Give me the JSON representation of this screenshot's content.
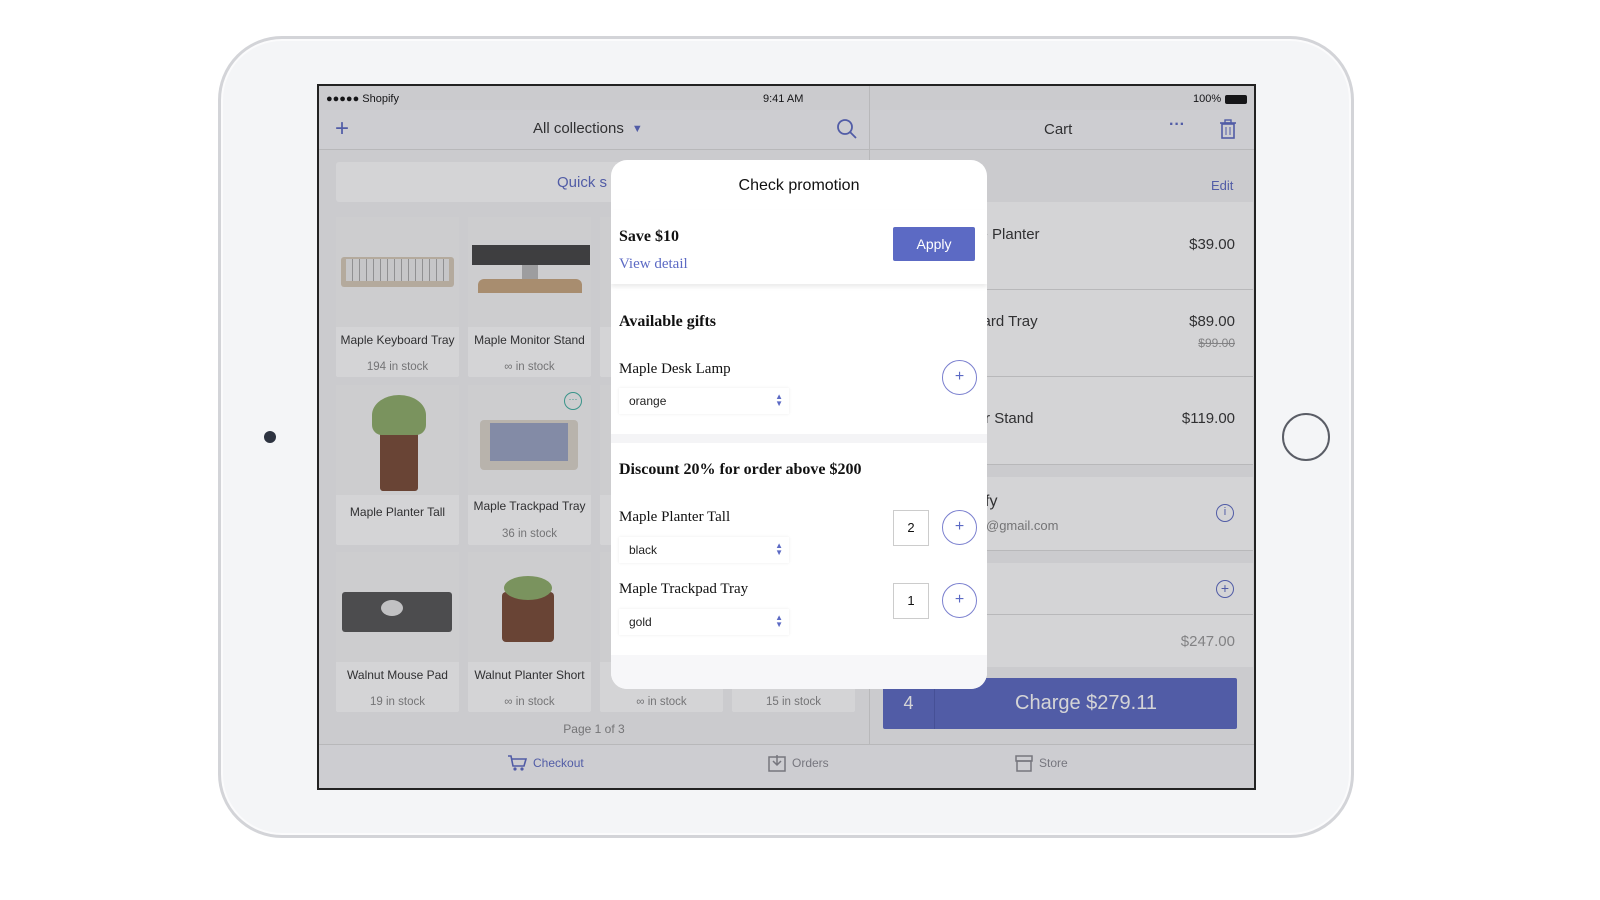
{
  "status_bar": {
    "carrier": "●●●●● Shopify",
    "time": "9:41 AM",
    "battery": "100%"
  },
  "products_header": {
    "add_icon": "plus-icon",
    "collection": "All collections",
    "search_icon": "search-icon"
  },
  "quick_sale": "Quick s",
  "products": [
    {
      "name": "Maple Keyboard Tray",
      "stock": "194 in stock"
    },
    {
      "name": "Maple Monitor Stand",
      "stock": "∞ in stock"
    },
    {
      "name": "Maple Planter Tall",
      "stock": ""
    },
    {
      "name": "Maple Trackpad Tray",
      "stock": "36 in stock"
    },
    {
      "name": "Walnut Mouse Pad",
      "stock": "19 in stock"
    },
    {
      "name": "Walnut Planter Short",
      "stock": "∞ in stock"
    },
    {
      "name": "",
      "stock": "∞ in stock"
    },
    {
      "name": "",
      "stock": "15 in stock"
    }
  ],
  "pagination": "Page 1 of 3",
  "cart": {
    "title": "Cart",
    "edit": "Edit",
    "items": [
      {
        "name": "Maple Planter",
        "price": "$39.00",
        "original": ""
      },
      {
        "name": "Maple Keyboard Tray",
        "price": "$89.00",
        "original": "$99.00"
      },
      {
        "name": "Maple Monitor Stand",
        "price": "$119.00",
        "original": ""
      }
    ],
    "customer_name": "fy",
    "customer_email": "@gmail.com",
    "subtotal": "$247.00",
    "item_count": "4",
    "charge": "Charge $279.11"
  },
  "tabs": [
    {
      "label": "Checkout",
      "icon": "cart-icon",
      "active": true
    },
    {
      "label": "Orders",
      "icon": "tray-download-icon"
    },
    {
      "label": "Store",
      "icon": "store-icon"
    }
  ],
  "modal": {
    "title": "Check promotion",
    "promo": {
      "title": "Save $10",
      "link": "View detail",
      "apply": "Apply"
    },
    "gifts": {
      "title": "Available gifts",
      "items": [
        {
          "name": "Maple Desk Lamp",
          "option": "orange"
        }
      ]
    },
    "discount": {
      "title": "Discount 20% for order above $200",
      "items": [
        {
          "name": "Maple Planter Tall",
          "option": "black",
          "qty": "2"
        },
        {
          "name": "Maple Trackpad Tray",
          "option": "gold",
          "qty": "1"
        }
      ]
    }
  },
  "colors": {
    "accent": "#5c6ac4",
    "apply": "#5c6ac4"
  }
}
